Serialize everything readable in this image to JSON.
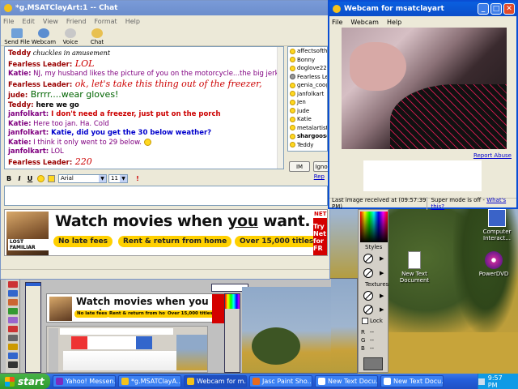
{
  "chat": {
    "title": "*g.MSATClayArt:1 -- Chat",
    "menu": [
      "File",
      "Edit",
      "View",
      "Friend",
      "Format",
      "Help"
    ],
    "tools": [
      {
        "label": "Send File",
        "color": "#6fa0d8"
      },
      {
        "label": "Webcam",
        "color": "#5c8ed0"
      },
      {
        "label": "Voice",
        "color": "#c8c8c8"
      },
      {
        "label": "Chat",
        "color": "#e8c050"
      }
    ],
    "messages": [
      {
        "user": "Teddy",
        "text": " chuckles in amusement",
        "user_class": "u-red",
        "msg_class": "m-script"
      },
      {
        "user": "Fearless Leader:",
        "text": " LOL",
        "user_class": "u-red",
        "msg_class": "m-red m-big"
      },
      {
        "user": "Katie:",
        "text": " NJ, my husband likes the picture of you on the motorcycle...the big jerk",
        "user_class": "u-purple",
        "msg_class": "m-purple"
      },
      {
        "user": "Fearless Leader:",
        "text": " ok, let's take this thing out of the freezer,",
        "user_class": "u-red",
        "msg_class": "m-red m-big"
      },
      {
        "user": "jude:",
        "text": " Brrrr....wear gloves!",
        "user_class": "u-red",
        "msg_class": "m-green"
      },
      {
        "user": "Teddy:",
        "text": " here we go",
        "user_class": "u-red",
        "msg_class": ""
      },
      {
        "user": "janfolkart:",
        "text": " I don't need a freezer, just put on the porch",
        "user_class": "u-purple",
        "msg_class": "m-blue u"
      },
      {
        "user": "Katie:",
        "text": " Here too jan. Ha. Cold",
        "user_class": "u-purple",
        "msg_class": "m-purple"
      },
      {
        "user": "janfolkart:",
        "text": " Katie, did you get the 30 below weather?",
        "user_class": "u-purple",
        "msg_class": "m-blue u"
      },
      {
        "user": "Katie:",
        "text": " I think it only went to 29 below.",
        "user_class": "u-purple",
        "msg_class": "m-purple"
      },
      {
        "user": "janfolkart:",
        "text": " LOL",
        "user_class": "u-purple",
        "msg_class": "m-purple"
      },
      {
        "user": "Fearless Leader:",
        "text": " 220",
        "user_class": "u-red",
        "msg_class": "m-red m-big"
      }
    ],
    "users": [
      "affectsofthe",
      "Bonny",
      "doglove220",
      "Fearless Lea",
      "genia_coog",
      "janfolkart",
      "Jen",
      "jude",
      "Katie",
      "metalartiste2",
      "shargoose",
      "Teddy"
    ],
    "im_button": "IM",
    "ignore_button": "Igno",
    "format": {
      "bold": "B",
      "italic": "I",
      "underline": "U",
      "font": "Arial",
      "size": "11"
    },
    "reply_link": "Rep",
    "ad": {
      "headline_a": "Watch movies when ",
      "headline_b": "you",
      "headline_c": " want.",
      "pills": [
        "No late fees",
        "Rent & return from home",
        "Over 15,000 titles"
      ],
      "brand": "NETFLIX",
      "cta": "Try Net for FR",
      "pic_caption": "LOST FAMILIAR"
    }
  },
  "webcam": {
    "title": "Webcam for msatclayart",
    "menu": [
      "File",
      "Webcam",
      "Help"
    ],
    "report": "Report Abuse",
    "last_image": "Last image received at (09:57:39 PM)",
    "super_mode": "Super mode is off - ",
    "whats_this": "What's this?"
  },
  "palette": {
    "styles": "Styles",
    "textures": "Textures",
    "lock": "Lock",
    "r": "R",
    "g": "G",
    "b": "B",
    "dash": "--"
  },
  "desktop_icons": [
    {
      "label": "Computer Interact...",
      "color": "#3a63c8"
    },
    {
      "label": "New Text Document",
      "color": "#ffffff"
    },
    {
      "label": "PowerDVD",
      "color": "#c02a9a"
    }
  ],
  "taskbar": {
    "start": "start",
    "tasks": [
      {
        "label": "Yahoo! Messen...",
        "color": "#7b2cbf"
      },
      {
        "label": "*g.MSATClayA...",
        "color": "#f4c21b"
      },
      {
        "label": "Webcam for m...",
        "color": "#f4c21b"
      },
      {
        "label": "Jasc Paint Sho...",
        "color": "#e86a1b"
      },
      {
        "label": "New Text Docu...",
        "color": "#ffffff"
      },
      {
        "label": "New Text Docu...",
        "color": "#ffffff"
      }
    ],
    "clock": "9:57 PM"
  },
  "mini_ad": {
    "headline": "Watch movies when you want.",
    "pills": [
      "No late fees",
      "Rent & return from home",
      "Over 15,000 titles"
    ]
  }
}
